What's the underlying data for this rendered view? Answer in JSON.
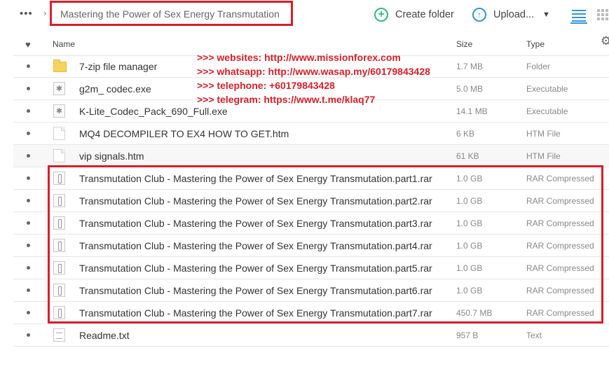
{
  "toolbar": {
    "more_glyph": "•••",
    "separator_glyph": "›",
    "path_value": "Mastering the Power of Sex Energy Transmutation",
    "create_folder_label": "Create folder",
    "upload_label": "Upload...",
    "plus_glyph": "+",
    "upload_arrow_glyph": "↑",
    "caret_glyph": "▼"
  },
  "columns": {
    "name": "Name",
    "size": "Size",
    "type": "Type",
    "heart_glyph": "♥",
    "gear_glyph": "⚙"
  },
  "files": [
    {
      "name": "7-zip file manager",
      "size": "1.7 MB",
      "type": "Folder",
      "icon": "folder-icon"
    },
    {
      "name": "g2m_ codec.exe",
      "size": "5.0 MB",
      "type": "Executable",
      "icon": "executable-icon"
    },
    {
      "name": "K-Lite_Codec_Pack_690_Full.exe",
      "size": "14.1 MB",
      "type": "Executable",
      "icon": "executable-icon"
    },
    {
      "name": "MQ4 DECOMPILER TO EX4 HOW TO GET.htm",
      "size": "6 KB",
      "type": "HTM File",
      "icon": "document-icon"
    },
    {
      "name": "vip signals.htm",
      "size": "61 KB",
      "type": "HTM File",
      "icon": "document-icon"
    },
    {
      "name": "Transmutation Club - Mastering the Power of Sex Energy Transmutation.part1.rar",
      "size": "1.0 GB",
      "type": "RAR Compressed",
      "icon": "archive-icon"
    },
    {
      "name": "Transmutation Club - Mastering the Power of Sex Energy Transmutation.part2.rar",
      "size": "1.0 GB",
      "type": "RAR Compressed",
      "icon": "archive-icon"
    },
    {
      "name": "Transmutation Club - Mastering the Power of Sex Energy Transmutation.part3.rar",
      "size": "1.0 GB",
      "type": "RAR Compressed",
      "icon": "archive-icon"
    },
    {
      "name": "Transmutation Club - Mastering the Power of Sex Energy Transmutation.part4.rar",
      "size": "1.0 GB",
      "type": "RAR Compressed",
      "icon": "archive-icon"
    },
    {
      "name": "Transmutation Club - Mastering the Power of Sex Energy Transmutation.part5.rar",
      "size": "1.0 GB",
      "type": "RAR Compressed",
      "icon": "archive-icon"
    },
    {
      "name": "Transmutation Club - Mastering the Power of Sex Energy Transmutation.part6.rar",
      "size": "1.0 GB",
      "type": "RAR Compressed",
      "icon": "archive-icon"
    },
    {
      "name": "Transmutation Club - Mastering the Power of Sex Energy Transmutation.part7.rar",
      "size": "450.7 MB",
      "type": "RAR Compressed",
      "icon": "archive-icon"
    },
    {
      "name": "Readme.txt",
      "size": "957 B",
      "type": "Text",
      "icon": "text-file-icon"
    }
  ],
  "watermark": {
    "lines": [
      ">>> websites: http://www.missionforex.com",
      ">>> whatsapp: http://www.wasap.my/60179843428",
      ">>> telephone: +60179843428",
      ">>> telegram: https://www.t.me/klaq77"
    ]
  },
  "colors": {
    "highlight_red": "#d6202a",
    "accent_blue": "#3594d0",
    "accent_green": "#3bb583"
  }
}
